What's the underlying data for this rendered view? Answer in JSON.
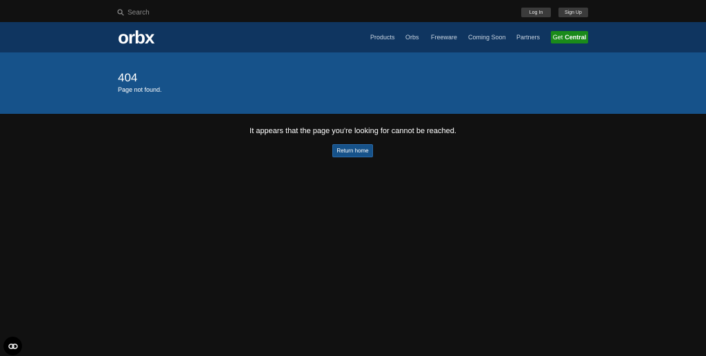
{
  "topbar": {
    "search_label": "Search",
    "login_label": "Log In",
    "signup_label": "Sign Up"
  },
  "navbar": {
    "logo": "orbx",
    "links": [
      "Products",
      "Orbs",
      "Freeware",
      "Coming Soon",
      "Partners"
    ],
    "cta_prefix": "Get",
    "cta_bold": "Central"
  },
  "hero": {
    "title": "404",
    "subtitle": "Page not found."
  },
  "main": {
    "message": "It appears that the page you're looking for cannot be reached.",
    "return_label": "Return home"
  },
  "icons": {
    "search": "search-icon",
    "corner": "link-icon"
  },
  "colors": {
    "background": "#111111",
    "navbar": "#0f3560",
    "hero": "#16528a",
    "cta_green": "#1a8a1a"
  }
}
